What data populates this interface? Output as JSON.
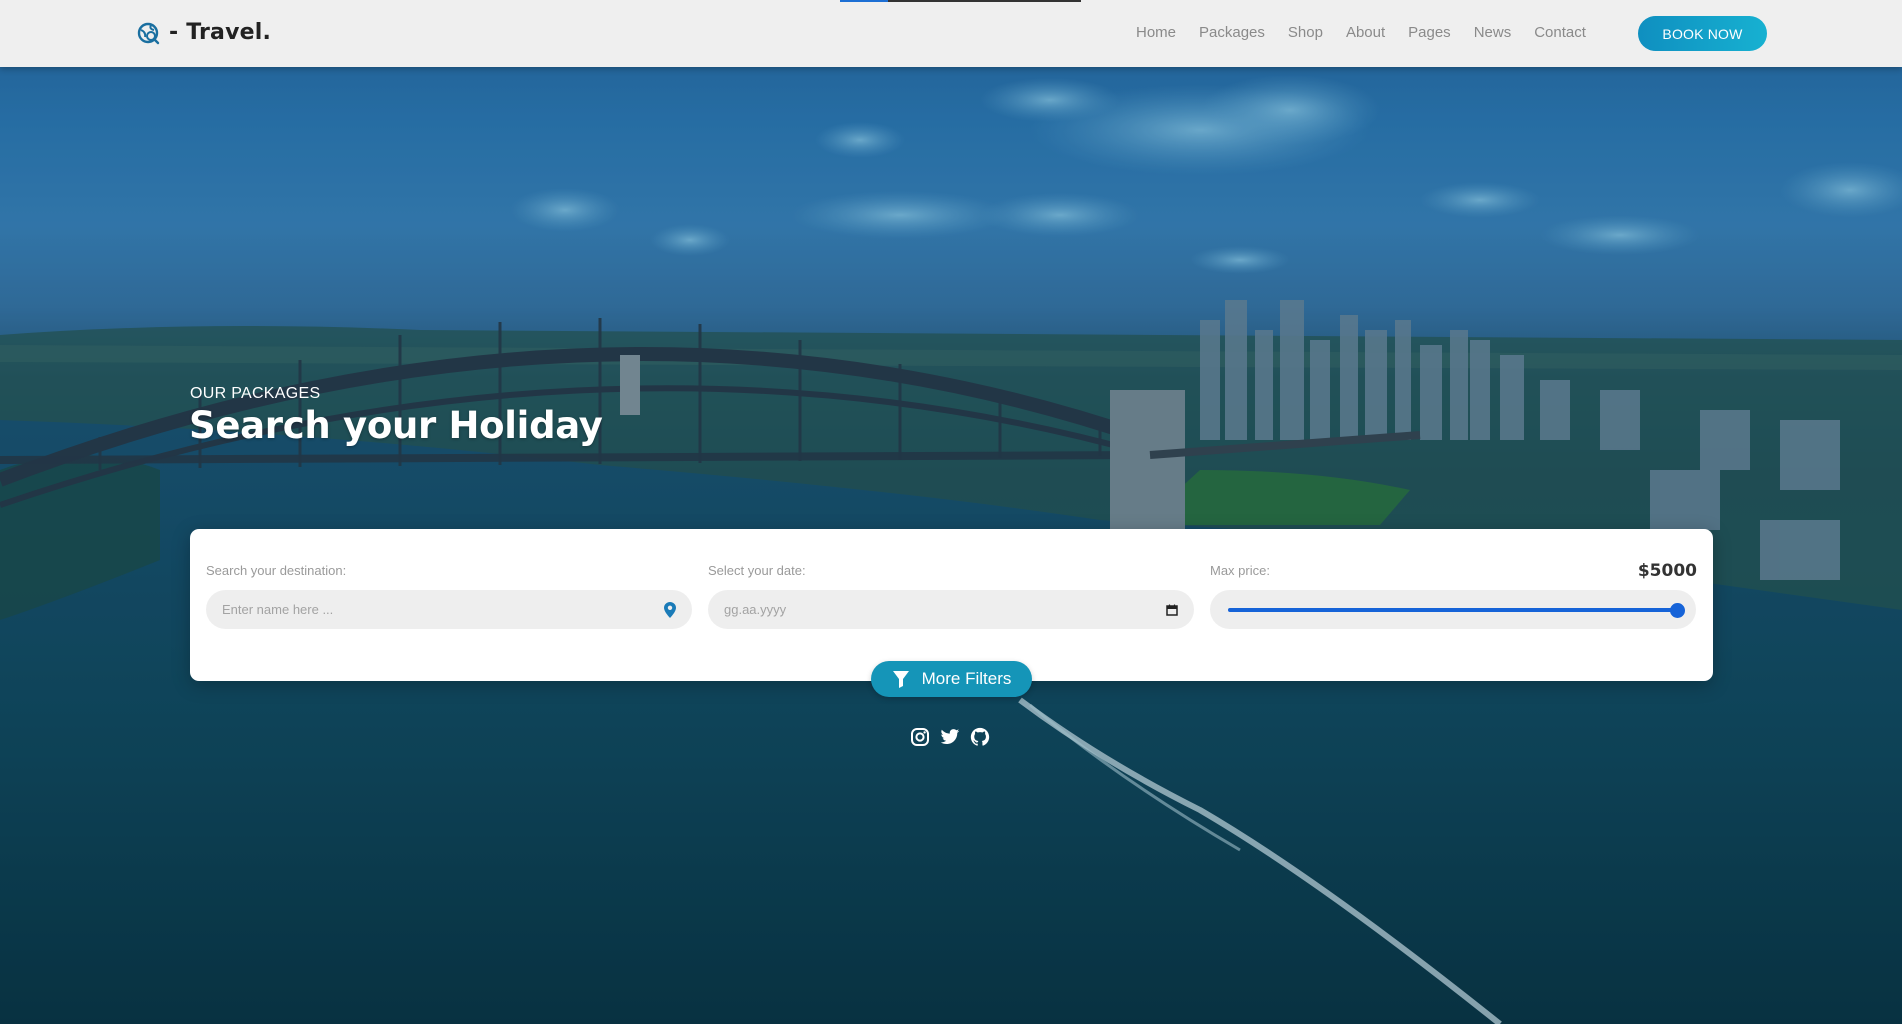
{
  "header": {
    "brand": "- Travel.",
    "nav": [
      {
        "label": "Home"
      },
      {
        "label": "Packages"
      },
      {
        "label": "Shop"
      },
      {
        "label": "About"
      },
      {
        "label": "Pages"
      },
      {
        "label": "News"
      },
      {
        "label": "Contact"
      }
    ],
    "cta_label": "BOOK NOW",
    "scroll_progress": 0.2
  },
  "hero": {
    "eyebrow": "OUR PACKAGES",
    "title": "Search your Holiday"
  },
  "search": {
    "destination": {
      "label": "Search your destination:",
      "placeholder": "Enter name here ...",
      "icon": "map-pin-icon"
    },
    "date": {
      "label": "Select your date:",
      "placeholder": "gg.aa.yyyy",
      "icon": "calendar-icon"
    },
    "price": {
      "label": "Max price:",
      "display": "$5000",
      "value": 5000,
      "max": 5000
    }
  },
  "filters_button": {
    "label": "More Filters",
    "icon": "filter-icon"
  },
  "socials": [
    {
      "name": "instagram-icon"
    },
    {
      "name": "twitter-icon"
    },
    {
      "name": "github-icon"
    }
  ],
  "colors": {
    "accent": "#1595b8",
    "slider": "#1663d8",
    "header_bg": "#efefef"
  }
}
